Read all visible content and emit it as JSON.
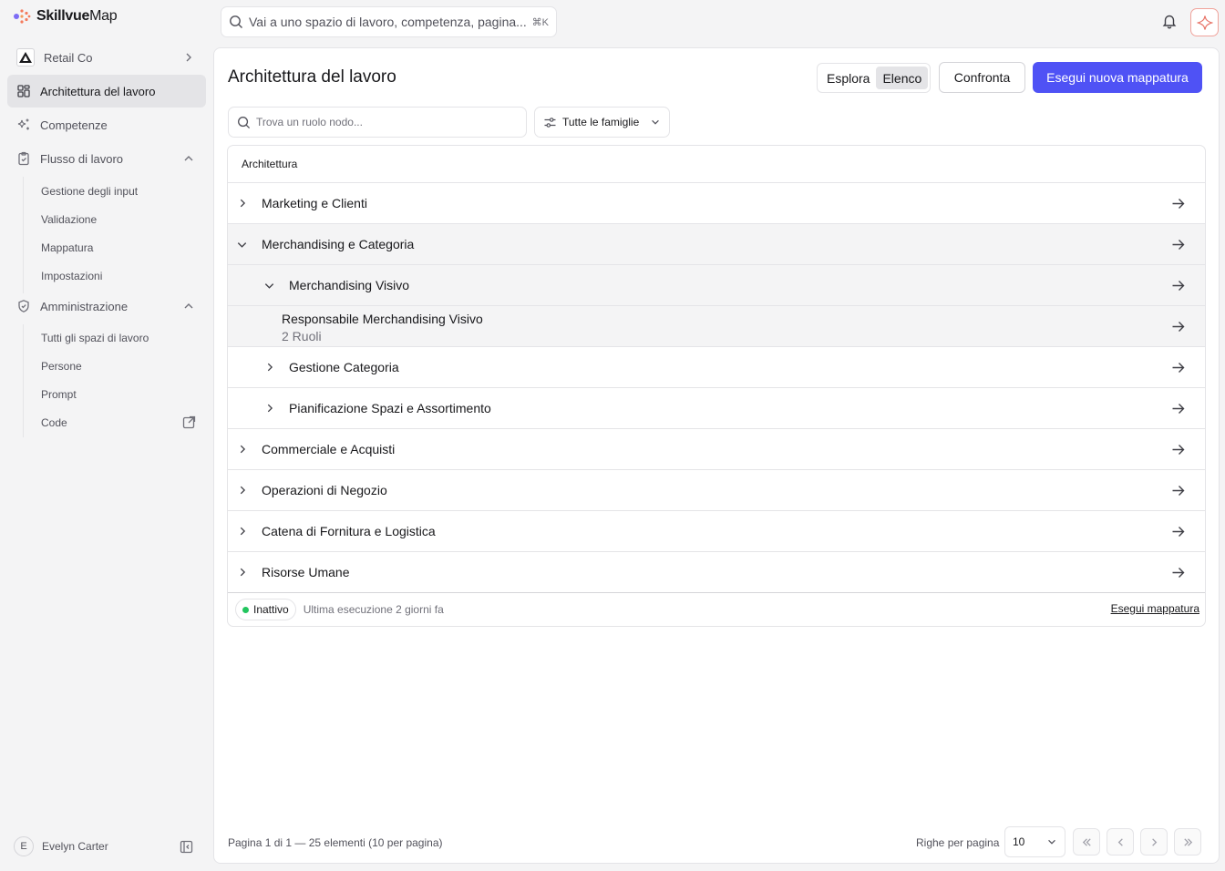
{
  "brand": {
    "name_bold": "Skillvue",
    "name_light": "Map",
    "accent": "#4f52f5"
  },
  "search": {
    "placeholder": "Vai a uno spazio di lavoro, competenza, pagina...",
    "shortcut": "⌘K"
  },
  "sidebar": {
    "org": "Retail Co",
    "items": [
      {
        "label": "Architettura del lavoro",
        "icon": "grid-icon",
        "active": true
      },
      {
        "label": "Competenze",
        "icon": "sparkles-icon"
      },
      {
        "label": "Flusso di lavoro",
        "icon": "clipboard-icon"
      },
      {
        "label": "Amministrazione",
        "icon": "shield-icon"
      }
    ],
    "workflow_sub": [
      "Gestione degli input",
      "Validazione",
      "Mappatura",
      "Impostazioni"
    ],
    "admin_sub": [
      "Tutti gli spazi di lavoro",
      "Persone",
      "Prompt",
      "Code"
    ],
    "user": {
      "initial": "E",
      "name": "Evelyn Carter"
    }
  },
  "main": {
    "title": "Architettura del lavoro",
    "view_toggle": {
      "options": [
        "Esplora",
        "Elenco"
      ],
      "selected": "Elenco"
    },
    "compare_label": "Confronta",
    "run_new_label": "Esegui nuova mappatura",
    "node_search_placeholder": "Trova un ruolo nodo...",
    "family_filter": "Tutte le famiglie",
    "table": {
      "header": "Architettura",
      "rows": [
        {
          "label": "Marketing e Clienti",
          "level": 0,
          "expanded": false
        },
        {
          "label": "Merchandising e Categoria",
          "level": 0,
          "expanded": true
        },
        {
          "label": "Merchandising Visivo",
          "level": 1,
          "expanded": true
        },
        {
          "label": "Responsabile Merchandising Visivo",
          "sub": "2 Ruoli",
          "level": 2
        },
        {
          "label": "Gestione Categoria",
          "level": 1,
          "expanded": false
        },
        {
          "label": "Pianificazione Spazi e Assortimento",
          "level": 1,
          "expanded": false
        },
        {
          "label": "Commerciale e Acquisti",
          "level": 0,
          "expanded": false
        },
        {
          "label": "Operazioni di Negozio",
          "level": 0,
          "expanded": false
        },
        {
          "label": "Catena di Fornitura e Logistica",
          "level": 0,
          "expanded": false
        },
        {
          "label": "Risorse Umane",
          "level": 0,
          "expanded": false
        }
      ],
      "footer": {
        "status": "Inattivo",
        "status_color": "#22c55e",
        "last_run": "Ultima esecuzione 2 giorni fa",
        "run_link": "Esegui mappatura"
      }
    },
    "pagination": {
      "info": "Pagina 1 di 1 — 25 elementi (10 per pagina)",
      "rows_label": "Righe per pagina",
      "rows_value": "10"
    }
  }
}
